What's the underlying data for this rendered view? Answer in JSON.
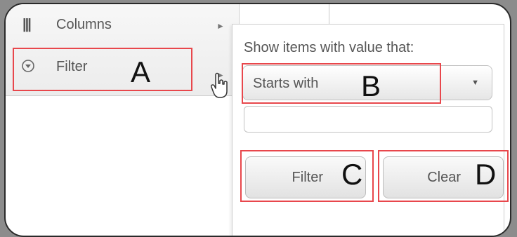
{
  "menu": {
    "items": [
      {
        "label": "Columns",
        "icon": "columns-icon"
      },
      {
        "label": "Filter",
        "icon": "filter-icon"
      }
    ]
  },
  "filter_panel": {
    "heading": "Show items with value that:",
    "condition": {
      "selected": "Starts with",
      "icon": "dropdown-arrow-icon"
    },
    "value_input": {
      "value": "",
      "placeholder": ""
    },
    "buttons": {
      "filter": "Filter",
      "clear": "Clear"
    }
  },
  "callouts": {
    "a": "A",
    "b": "B",
    "c": "C",
    "d": "D"
  },
  "colors": {
    "highlight": "#e8474c",
    "callout_text": "#111111"
  }
}
